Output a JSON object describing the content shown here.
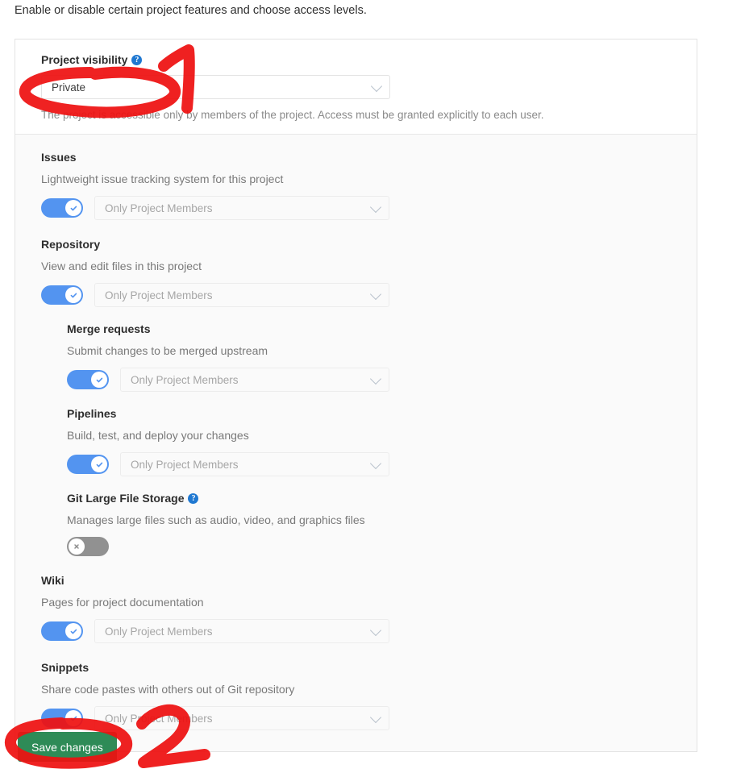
{
  "page": {
    "intro": "Enable or disable certain project features and choose access levels."
  },
  "visibility": {
    "label": "Project visibility",
    "help_icon": "question-circle-icon",
    "value": "Private",
    "help_text": "The project is accessible only by members of the project. Access must be granted explicitly to each user."
  },
  "features": [
    {
      "title": "Issues",
      "description": "Lightweight issue tracking system for this project",
      "toggle": "on",
      "access": "Only Project Members"
    },
    {
      "title": "Repository",
      "description": "View and edit files in this project",
      "toggle": "on",
      "access": "Only Project Members"
    },
    {
      "title": "Merge requests",
      "description": "Submit changes to be merged upstream",
      "toggle": "on",
      "access": "Only Project Members"
    },
    {
      "title": "Pipelines",
      "description": "Build, test, and deploy your changes",
      "toggle": "on",
      "access": "Only Project Members"
    },
    {
      "title": "Git Large File Storage",
      "description": "Manages large files such as audio, video, and graphics files",
      "toggle": "off",
      "help_icon": "question-circle-icon"
    },
    {
      "title": "Wiki",
      "description": "Pages for project documentation",
      "toggle": "on",
      "access": "Only Project Members"
    },
    {
      "title": "Snippets",
      "description": "Share code pastes with others out of Git repository",
      "toggle": "on",
      "access": "Only Project Members"
    }
  ],
  "actions": {
    "save_label": "Save changes"
  },
  "annotations": [
    {
      "label": "1",
      "target": "visibility-select"
    },
    {
      "label": "2",
      "target": "save-button"
    }
  ],
  "colors": {
    "toggle_on": "#5394f0",
    "toggle_off": "#919191",
    "save_button": "#2e8b57",
    "help_icon": "#1f78d1",
    "annotation": "#ee1111"
  }
}
